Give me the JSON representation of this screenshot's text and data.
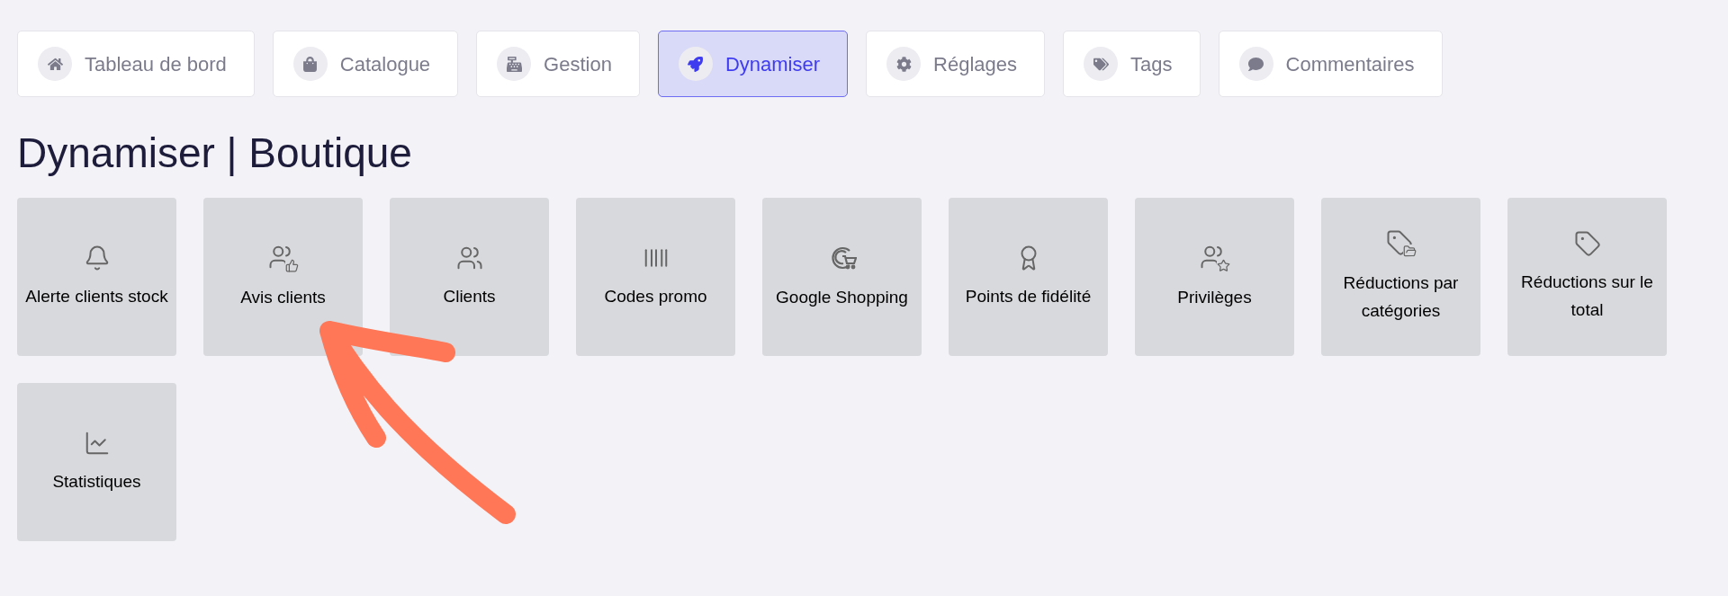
{
  "tabs": [
    {
      "label": "Tableau de bord",
      "selected": false
    },
    {
      "label": "Catalogue",
      "selected": false
    },
    {
      "label": "Gestion",
      "selected": false
    },
    {
      "label": "Dynamiser",
      "selected": true
    },
    {
      "label": "Réglages",
      "selected": false
    },
    {
      "label": "Tags",
      "selected": false
    },
    {
      "label": "Commentaires",
      "selected": false
    }
  ],
  "page_title": "Dynamiser | Boutique",
  "tiles": [
    {
      "label": "Alerte clients stock"
    },
    {
      "label": "Avis clients"
    },
    {
      "label": "Clients"
    },
    {
      "label": "Codes promo"
    },
    {
      "label": "Google Shopping"
    },
    {
      "label": "Points de fidélité"
    },
    {
      "label": "Privilèges"
    },
    {
      "label": "Réductions par catégories"
    },
    {
      "label": "Réductions sur le total"
    },
    {
      "label": "Statistiques"
    }
  ]
}
